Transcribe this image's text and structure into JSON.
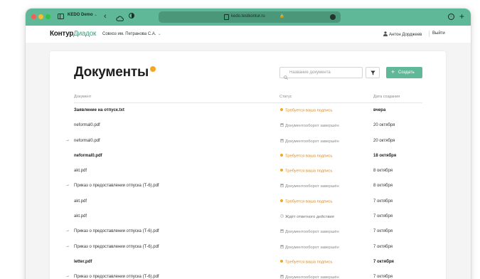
{
  "browser": {
    "tab_group": "KEDO Demo",
    "url": "kedo.testkontur.ru",
    "lock": "🔒"
  },
  "header": {
    "logo_part1": "Контур",
    "logo_part2": "Диадок",
    "organization": "Совхоз им. Петранова С.А.",
    "user_name": "Антон Дорджеев",
    "logout": "Выйти"
  },
  "page": {
    "title": "Документы",
    "search_placeholder": "Название документа",
    "create_label": "Создать"
  },
  "table": {
    "columns": [
      "Документ",
      "Статус",
      "Дата создания"
    ],
    "rows": [
      {
        "name": "Заявление на отпуск.txt",
        "status": "Требуется ваша подпись",
        "status_type": "sign",
        "date": "вчера",
        "unread": true,
        "forwarded": false
      },
      {
        "name": "neformal0.pdf",
        "status": "Документооборот завершён",
        "status_type": "done",
        "date": "20 октября",
        "unread": false,
        "forwarded": false
      },
      {
        "name": "neformal0.pdf",
        "status": "Документооборот завершён",
        "status_type": "done",
        "date": "20 октября",
        "unread": false,
        "forwarded": true
      },
      {
        "name": "neformal0.pdf",
        "status": "Требуется ваша подпись",
        "status_type": "sign",
        "date": "18 октября",
        "unread": true,
        "forwarded": false
      },
      {
        "name": "akt.pdf",
        "status": "Требуется ваша подпись",
        "status_type": "sign",
        "date": "8 октября",
        "unread": false,
        "forwarded": false
      },
      {
        "name": "Приказ о предоставлении отпуска (Т-6).pdf",
        "status": "Документооборот завершён",
        "status_type": "done",
        "date": "8 октября",
        "unread": false,
        "forwarded": true
      },
      {
        "name": "akt.pdf",
        "status": "Требуется ваша подпись",
        "status_type": "sign",
        "date": "7 октября",
        "unread": false,
        "forwarded": false
      },
      {
        "name": "akt.pdf",
        "status": "Ждёт ответного действия",
        "status_type": "wait",
        "date": "7 октября",
        "unread": false,
        "forwarded": false
      },
      {
        "name": "Приказ о предоставлении отпуска (Т-6).pdf",
        "status": "Документооборот завершён",
        "status_type": "done",
        "date": "7 октября",
        "unread": false,
        "forwarded": true
      },
      {
        "name": "Приказ о предоставлении отпуска (Т-6).pdf",
        "status": "Документооборот завершён",
        "status_type": "done",
        "date": "7 октября",
        "unread": false,
        "forwarded": true
      },
      {
        "name": "letter.pdf",
        "status": "Требуется ваша подпись",
        "status_type": "sign",
        "date": "7 октября",
        "unread": true,
        "forwarded": false
      },
      {
        "name": "Приказ о предоставлении отпуска (Т-6).pdf",
        "status": "Документооборот завершён",
        "status_type": "done",
        "date": "7 октября",
        "unread": false,
        "forwarded": true
      }
    ]
  },
  "colors": {
    "brand_green": "#5fb897",
    "sign_orange": "#d98a1c",
    "badge_orange": "#f5a623"
  }
}
